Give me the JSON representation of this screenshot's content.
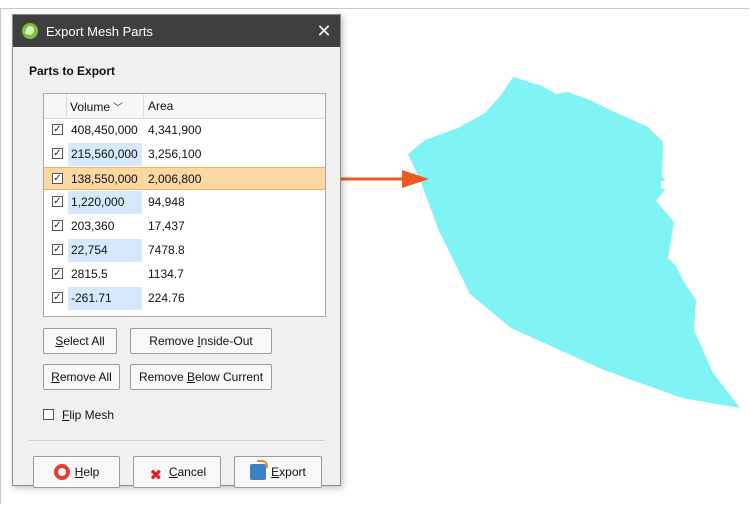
{
  "dialog": {
    "title": "Export Mesh Parts",
    "close_glyph": "✕",
    "section_label": "Parts to Export",
    "table": {
      "headers": [
        "Volume",
        "Area"
      ],
      "sort_indicator": "chevron-down",
      "rows": [
        {
          "checked": true,
          "volume": "408,450,000",
          "area": "4,341,900",
          "volume_highlight": false,
          "selected": false
        },
        {
          "checked": true,
          "volume": "215,560,000",
          "area": "3,256,100",
          "volume_highlight": true,
          "selected": false
        },
        {
          "checked": true,
          "volume": "138,550,000",
          "area": "2,006,800",
          "volume_highlight": false,
          "selected": true
        },
        {
          "checked": true,
          "volume": "1,220,000",
          "area": "94,948",
          "volume_highlight": true,
          "selected": false
        },
        {
          "checked": true,
          "volume": "203,360",
          "area": "17,437",
          "volume_highlight": false,
          "selected": false
        },
        {
          "checked": true,
          "volume": "22,754",
          "area": "7478.8",
          "volume_highlight": true,
          "selected": false
        },
        {
          "checked": true,
          "volume": "2815.5",
          "area": "1134.7",
          "volume_highlight": false,
          "selected": false
        },
        {
          "checked": true,
          "volume": "-261.71",
          "area": "224.76",
          "volume_highlight": true,
          "selected": false
        }
      ]
    },
    "buttons": {
      "select_all": {
        "mnemonic": "S",
        "rest": "elect All"
      },
      "remove_inside_out_pre": "Remove ",
      "remove_inside_out_mn": "I",
      "remove_inside_out_post": "nside-Out",
      "remove_all": {
        "mnemonic": "R",
        "rest": "emove All"
      },
      "remove_below_pre": "Remove ",
      "remove_below_mn": "B",
      "remove_below_post": "elow Current"
    },
    "flip_mesh": {
      "checked": false,
      "mnemonic": "F",
      "rest": "lip Mesh"
    },
    "footer": {
      "help": {
        "mnemonic": "H",
        "rest": "elp"
      },
      "cancel": {
        "mnemonic": "C",
        "rest": "ancel"
      },
      "export": {
        "mnemonic": "E",
        "rest": "xport"
      }
    }
  },
  "viewport": {
    "mesh_color": "#80f3f5",
    "arrow_color": "#ee5a1f",
    "selection_color": "#fbd7a4",
    "volume_highlight_color": "#d6e8fb"
  }
}
